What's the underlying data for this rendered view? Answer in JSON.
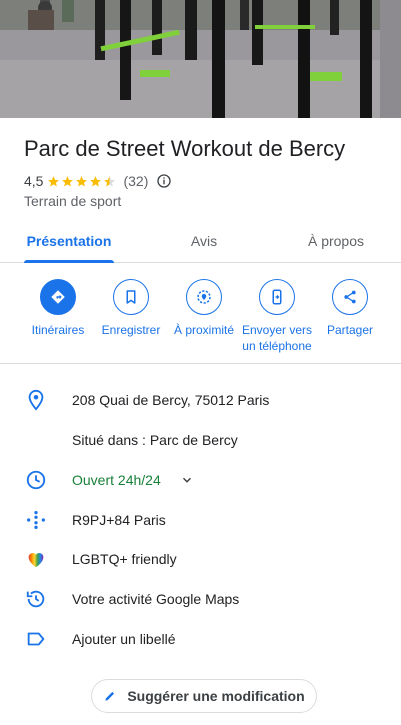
{
  "place": {
    "name": "Parc de Street Workout de Bercy",
    "rating": "4,5",
    "stars": 4.5,
    "reviews": "(32)",
    "category": "Terrain de sport"
  },
  "tabs": [
    {
      "label": "Présentation",
      "active": true
    },
    {
      "label": "Avis",
      "active": false
    },
    {
      "label": "À propos",
      "active": false
    }
  ],
  "actions": [
    {
      "label": "Itinéraires",
      "icon": "directions-icon"
    },
    {
      "label": "Enregistrer",
      "icon": "bookmark-icon"
    },
    {
      "label": "À proximité",
      "icon": "nearby-icon"
    },
    {
      "label": "Envoyer vers un téléphone",
      "icon": "send-to-phone-icon"
    },
    {
      "label": "Partager",
      "icon": "share-icon"
    }
  ],
  "details": {
    "address": "208 Quai de Bercy, 75012 Paris",
    "located_in": "Situé dans : Parc de Bercy",
    "hours": "Ouvert 24h/24",
    "plus_code": "R9PJ+84 Paris",
    "lgbtq": "LGBTQ+ friendly",
    "activity": "Votre activité Google Maps",
    "label": "Ajouter un libellé"
  },
  "suggest_button": "Suggérer une modification",
  "colors": {
    "accent": "#1a73e8",
    "open": "#188038",
    "star": "#fbbc04",
    "divider": "#dadce0"
  }
}
